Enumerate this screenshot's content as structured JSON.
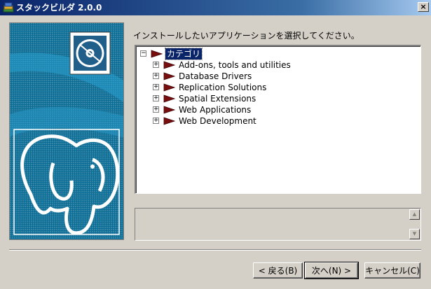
{
  "window": {
    "title": "スタックビルダ 2.0.0",
    "close_glyph": "×"
  },
  "banner": {
    "background_color": "#0b6d95",
    "logo": "postgresql-elephant",
    "disc_icon": "cd-icon"
  },
  "instruction": "インストールしたいアプリケーションを選択してください。",
  "tree": {
    "root": {
      "label": "カテゴリ",
      "expander": "−",
      "selected": true
    },
    "items": [
      {
        "label": "Add-ons, tools and utilities",
        "expander": "+"
      },
      {
        "label": "Database Drivers",
        "expander": "+"
      },
      {
        "label": "Replication Solutions",
        "expander": "+"
      },
      {
        "label": "Spatial Extensions",
        "expander": "+"
      },
      {
        "label": "Web Applications",
        "expander": "+"
      },
      {
        "label": "Web Development",
        "expander": "+"
      }
    ],
    "flag_color": "#7a0e0e"
  },
  "description": {
    "text": "",
    "scroll_up": "▲",
    "scroll_down": "▼"
  },
  "buttons": {
    "back": "< 戻る(B)",
    "next": "次へ(N) >",
    "cancel": "キャンセル(C)"
  }
}
